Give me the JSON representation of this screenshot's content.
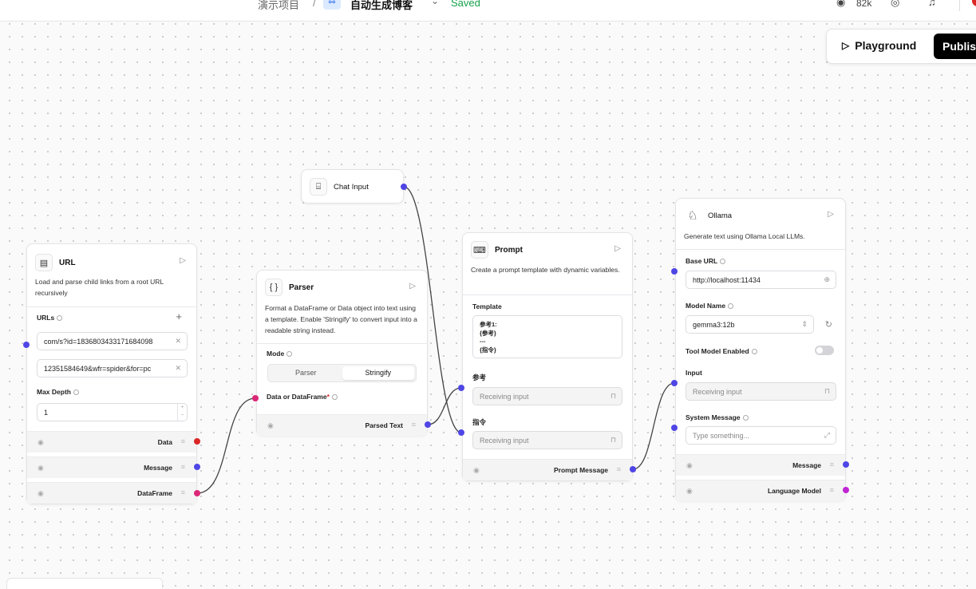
{
  "topbar": {
    "project": "演示项目",
    "separator": "/",
    "flow_name": "自动生成博客",
    "chevron": "chevron-down-icon",
    "saved": "Saved",
    "github_stars": "82k"
  },
  "toolbar": {
    "playground": "Playground",
    "publish": "Publish"
  },
  "nodes": {
    "url": {
      "title": "URL",
      "description": "Load and parse child links from a root URL recursively",
      "urls_label": "URLs",
      "url1": "com/s?id=1836803433171684098",
      "url2": "12351584649&wfr=spider&for=pc",
      "max_depth_label": "Max Depth",
      "max_depth": "1",
      "outputs": [
        "Data",
        "Message",
        "DataFrame"
      ]
    },
    "chat_input": {
      "title": "Chat Input"
    },
    "parser": {
      "title": "Parser",
      "description": "Format a DataFrame or Data object into text using a template. Enable 'Stringify' to convert input into a readable string instead.",
      "mode_label": "Mode",
      "mode_options": [
        "Parser",
        "Stringify"
      ],
      "input_label": "Data or DataFrame",
      "required": "*",
      "output": "Parsed Text"
    },
    "prompt": {
      "title": "Prompt",
      "description": "Create a prompt template with dynamic variables.",
      "template_label": "Template",
      "template_lines": [
        "参考1:",
        "{参考}",
        "---",
        "{指令}"
      ],
      "var1_label": "参考",
      "var2_label": "指令",
      "receiving": "Receiving input",
      "output": "Prompt Message"
    },
    "ollama": {
      "title": "Ollama",
      "description": "Generate text using Ollama Local LLMs.",
      "base_url_label": "Base URL",
      "base_url": "http://localhost:11434",
      "model_name_label": "Model Name",
      "model_name": "gemma3:12b",
      "tool_model_label": "Tool Model Enabled",
      "input_label": "Input",
      "receiving": "Receiving input",
      "system_message_label": "System Message",
      "system_placeholder": "Type something...",
      "outputs": [
        "Message",
        "Language Model"
      ]
    }
  },
  "colors": {
    "handle_blue": "#4f46e5",
    "handle_red": "#dc2626",
    "handle_pink": "#db2777",
    "handle_magenta": "#c026d3",
    "saved_green": "#16a34a"
  }
}
